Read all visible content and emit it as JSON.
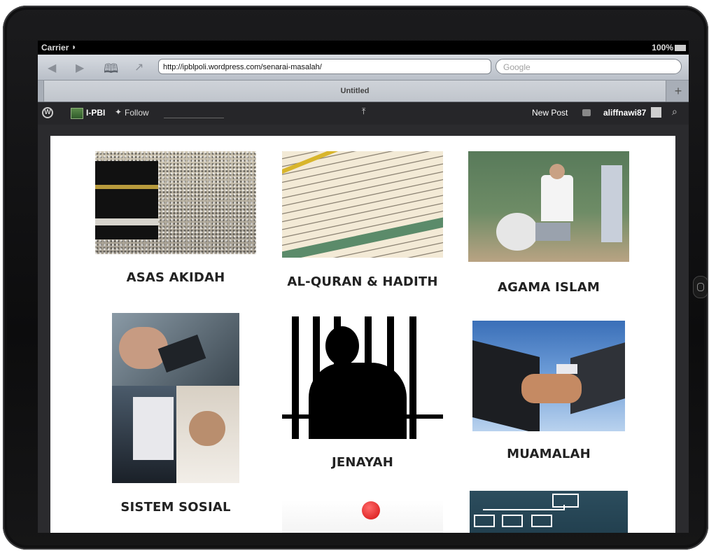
{
  "status_bar": {
    "carrier": "Carrier",
    "battery": "100%"
  },
  "browser": {
    "url": "http://ipblpoli.wordpress.com/senarai-masalah/",
    "search_placeholder": "Google",
    "tab_title": "Untitled",
    "new_tab_label": "+"
  },
  "admin_bar": {
    "site_name": "I-PBI",
    "follow_label": "Follow",
    "new_post_label": "New Post",
    "username": "aliffnawi87"
  },
  "categories": [
    {
      "title": "ASAS AKIDAH",
      "image": "kaaba-pilgrims"
    },
    {
      "title": "AL-QURAN & HADITH",
      "image": "quran-page"
    },
    {
      "title": "AGAMA ISLAM",
      "image": "classroom-teacher"
    },
    {
      "title": "SISTEM SOSIAL",
      "image": "phones-and-computer"
    },
    {
      "title": "JENAYAH",
      "image": "prisoner-silhouette"
    },
    {
      "title": "MUAMALAH",
      "image": "handshake"
    }
  ],
  "colors": {
    "title_text": "#222222",
    "admin_bar_bg": "#262629",
    "page_bg": "#ffffff"
  }
}
